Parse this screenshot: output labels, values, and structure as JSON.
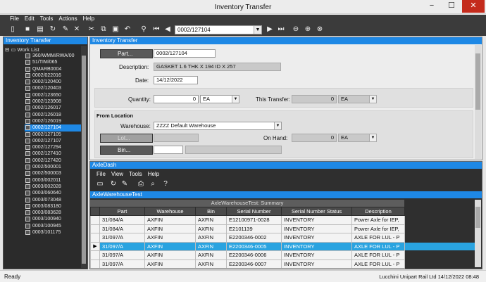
{
  "window": {
    "title": "Inventory Transfer",
    "minimize": "−",
    "maximize": "☐",
    "close": "✕"
  },
  "menu": [
    "File",
    "Edit",
    "Tools",
    "Actions",
    "Help"
  ],
  "toolbar": {
    "part_combo_value": "0002/127104"
  },
  "tree": {
    "header": "Inventory Transfer",
    "root_label": "Work List",
    "items": [
      "360/WMM/RWA/00",
      "51/TIM/065",
      "QMARB0004",
      "0002/022016",
      "0002/120400",
      "0002/120403",
      "0002/123650",
      "0002/123908",
      "0002/126017",
      "0002/126018",
      "0002/126019",
      "0002/127104",
      "0002/127105",
      "0002/127107",
      "0002/127294",
      "0002/127410",
      "0002/127420",
      "0002/500001",
      "0002/500003",
      "0003/002011",
      "0003/002028",
      "0003/060640",
      "0003/073048",
      "0003/083180",
      "0003/083628",
      "0003/100940",
      "0003/100945",
      "0003/101175"
    ],
    "selected_index": 11
  },
  "form": {
    "header": "Inventory Transfer",
    "part_button": "Part...",
    "part_value": "0002/127104",
    "description_label": "Description:",
    "description_value": "GASKET 1.6 THK X 194 ID X 257",
    "date_label": "Date:",
    "date_value": "14/12/2022",
    "quantity_label": "Quantity:",
    "quantity_value": "0",
    "quantity_uom": "EA",
    "this_transfer_label": "This Transfer:",
    "this_transfer_value": "0",
    "this_transfer_uom": "EA",
    "from_location_label": "From Location",
    "warehouse_label": "Warehouse:",
    "warehouse_value": "ZZZZ Default Warehouse",
    "lot_button": "Lot...",
    "on_hand_label": "On Hand:",
    "on_hand_value": "0",
    "on_hand_uom": "EA",
    "bin_button": "Bin..."
  },
  "axledash": {
    "header": "AxleDash",
    "menu": [
      "File",
      "View",
      "Tools",
      "Help"
    ],
    "subheader": "AxleWarehouseTest",
    "summary_title": "AxleWarehouseTest: Summary",
    "columns": [
      "Part",
      "Warehouse",
      "Bin",
      "Serial Number",
      "Serial Number Status",
      "Description"
    ],
    "rows": [
      [
        "31/084/A",
        "AXFIN",
        "AXFIN",
        "E12100971-0028",
        "INVENTORY",
        "Power Axle for IEP,"
      ],
      [
        "31/084/A",
        "AXFIN",
        "AXFIN",
        "E2101139",
        "INVENTORY",
        "Power Axle for IEP,"
      ],
      [
        "31/097/A",
        "AXFIN",
        "AXFIN",
        "E2200346-0002",
        "INVENTORY",
        "AXLE FOR LUL - P"
      ],
      [
        "31/097/A",
        "AXFIN",
        "AXFIN",
        "E2200346-0005",
        "INVENTORY",
        "AXLE FOR LUL - P"
      ],
      [
        "31/097/A",
        "AXFIN",
        "AXFIN",
        "E2200346-0006",
        "INVENTORY",
        "AXLE FOR LUL - P"
      ],
      [
        "31/097/A",
        "AXFIN",
        "AXFIN",
        "E2200346-0007",
        "INVENTORY",
        "AXLE FOR LUL - P"
      ]
    ],
    "selected_row": 3,
    "row_indicator": "▶"
  },
  "status": {
    "left": "Ready",
    "right": "Lucchini Unipart Rail Ltd  14/12/2022    08:48"
  },
  "colors": {
    "accent": "#1e88e5",
    "selection": "#29a3e0",
    "dark": "#3b3b3b"
  }
}
